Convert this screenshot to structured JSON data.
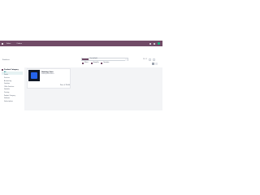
{
  "navbar": {
    "app_title": "Sales",
    "menu_label": "Orders",
    "bg_color": "#714b67"
  },
  "control": {
    "breadcrumb": "Products",
    "search": {
      "facet_label": "Products",
      "query": "Can be Sold",
      "placeholder": "Search..."
    },
    "search_options": [
      {
        "label": "Filters"
      },
      {
        "label": "Group By"
      },
      {
        "label": "Favorites"
      }
    ],
    "pager": {
      "value": "1-1 / 1"
    }
  },
  "sidepanel": {
    "header": "Product Category",
    "items": [
      {
        "label": "All",
        "active": true
      },
      {
        "label": "Desks"
      },
      {
        "label": "Services"
      },
      {
        "label": "Accounting"
      },
      {
        "label": "Furniture"
      },
      {
        "label": "Office Furniture"
      },
      {
        "label": "Saleable"
      },
      {
        "label": "Training"
      },
      {
        "label": "Product Category"
      },
      {
        "label": "Software"
      },
      {
        "label": "Subscriptions"
      }
    ]
  },
  "card": {
    "title": "Gaming Case",
    "subtitle": "Subscription Product",
    "price": "Price: $ 750.00",
    "image_color": "#2563eb"
  }
}
